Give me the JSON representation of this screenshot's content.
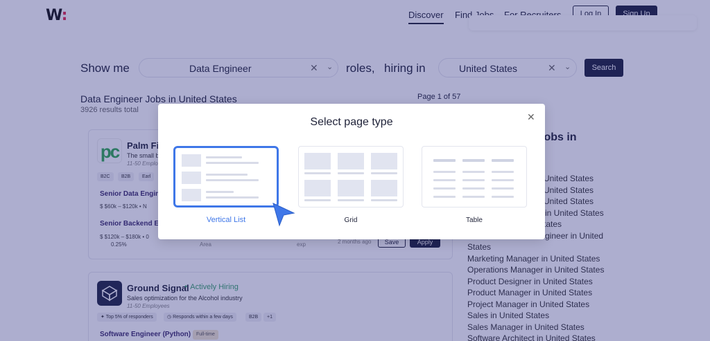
{
  "header": {
    "nav": [
      "Discover",
      "Find Jobs",
      "For Recruiters"
    ],
    "login": "Log In",
    "signup": "Sign Up"
  },
  "search": {
    "show_me": "Show me",
    "role_value": "Data Engineer",
    "roles_label": "roles,",
    "hiring_in": "hiring in",
    "location_value": "United States",
    "button": "Search"
  },
  "results": {
    "title": "Data Engineer Jobs in United States",
    "count": "3926 results total",
    "page": "Page 1 of 57"
  },
  "cards": [
    {
      "company": "Palm Fin",
      "desc": "The small b",
      "size": "11-50 Emplo",
      "tags": [
        "B2C",
        "B2B",
        "Earl"
      ],
      "roles": [
        {
          "title": "Senior Data Engine",
          "meta": "$60k – $120k • N"
        },
        {
          "title": "Senior Backend En",
          "meta": "$120k – $180k • 0",
          "meta2": "0.25%"
        }
      ],
      "area": "Area",
      "exp": "exp",
      "posted": "2 months ago",
      "save": "Save",
      "apply": "Apply"
    },
    {
      "company": "Ground Signal",
      "hiring": "Actively Hiring",
      "desc": "Sales optimization for the Alcohol industry",
      "size": "11-50 Employees",
      "tags": [
        "Top 5% of responders",
        "Responds within a few days",
        "B2B",
        "+1"
      ],
      "roles": [
        {
          "title": "Software Engineer (Python)",
          "badge": "Full-time"
        }
      ]
    }
  ],
  "sidebar": {
    "heading": "jobs in",
    "links": [
      "United States",
      "United States",
      "United States",
      "in United States",
      "tates",
      "gineer in United",
      "States",
      "Marketing Manager in United States",
      "Operations Manager in United States",
      "Product Designer in United States",
      "Product Manager in United States",
      "Project Manager in United States",
      "Sales in United States",
      "Sales Manager in United States",
      "Software Architect in United States"
    ]
  },
  "modal": {
    "title": "Select page type",
    "options": [
      "Vertical List",
      "Grid",
      "Table"
    ],
    "selected": "Vertical List"
  },
  "colors": {
    "overlay": "#282a80",
    "accent": "#3f77e8",
    "primary_button": "#1b1f3b",
    "hiring_green": "#3aa26a"
  }
}
